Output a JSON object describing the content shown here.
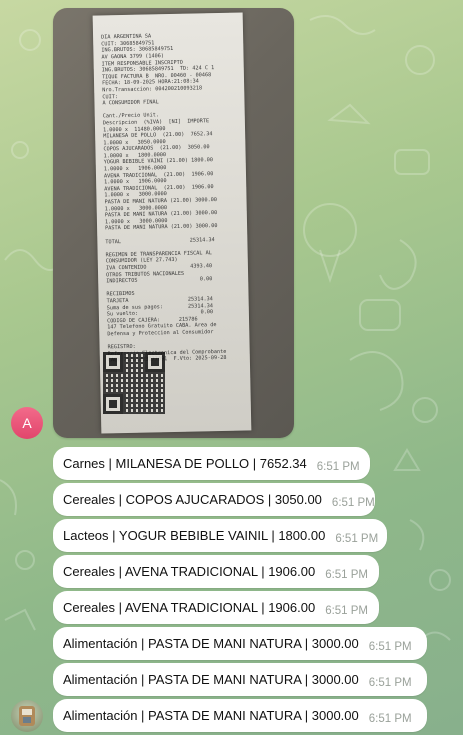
{
  "chat": {
    "sender_avatar_letter": "A",
    "receipt_lines": [
      "DIA ARGENTINA SA",
      "CUIT: 30685849751",
      "ING.BRUTOS: 30685849751",
      "AV GAONA 3799 (1406)",
      "ITEM RESPONSABLE INSCRIPTO",
      "ING.BRUTOS: 30685849751  TD: 424 C 1",
      "TIQUE FACTURA B  NRO. 00460 - 00468",
      "FECHA: 18-09-2025 HORA:21:08:34",
      "Nro.Transaccion: 004200210093218",
      "CUIT:",
      "A CONSUMIDOR FINAL",
      "",
      "Cant./Precio Unit.",
      "Descripcion  (%IVA)  [NI]  IMPORTE",
      "1.0000 x  11480.0000",
      "MILANESA DE POLLO  (21.00)  7652.34",
      "1.0000 x   3050.0000",
      "COPOS AJUCARADOS  (21.00)  3050.00",
      "1.0000 x   1800.0000",
      "YOGUR BEBIBLE VAINI (21.00) 1800.00",
      "1.0000 x   1906.0000",
      "AVENA TRADICIONAL  (21.00)  1906.00",
      "1.0000 x   1906.0000",
      "AVENA TRADICIONAL  (21.00)  1906.00",
      "1.0000 x   3000.0000",
      "PASTA DE MANI NATURA (21.00) 3000.00",
      "1.0000 x   3000.0000",
      "PASTA DE MANI NATURA (21.00) 3000.00",
      "1.0000 x   3000.0000",
      "PASTA DE MANI NATURA (21.00) 3000.00",
      "",
      "TOTAL                      25314.34",
      "",
      "REGIMEN DE TRANSPARENCIA FISCAL AL",
      "CONSUMIDOR (LEY 27.743)",
      "IVA CONTENIDO              4393.40",
      "OTROS TRIBUTOS NACIONALES",
      "INDIRECTOS                    0.00",
      "",
      "RECIBIMOS",
      "TARJETA                   25314.34",
      "Suma de sus pagos:        25314.34",
      "Su vuelto:                    0.00",
      "CODIGO DE CAJERA:      215786",
      "147 Telefono Gratuito CABA. Area de",
      "Defensa y Proteccion al Consumidor",
      "",
      "REGISTRO:",
      "Referencia Electronica del Comprobante",
      "CAE: 75381883177091  F.Vto: 2025-09-28"
    ],
    "messages": [
      {
        "text": "Carnes | MILANESA DE POLLO | 7652.34",
        "time": "6:51 PM"
      },
      {
        "text": "Cereales | COPOS AJUCARADOS | 3050.00",
        "time": "6:51 PM"
      },
      {
        "text": "Lacteos | YOGUR BEBIBLE VAINIL | 1800.00",
        "time": "6:51 PM"
      },
      {
        "text": "Cereales | AVENA TRADICIONAL | 1906.00",
        "time": "6:51 PM"
      },
      {
        "text": "Cereales | AVENA TRADICIONAL | 1906.00",
        "time": "6:51 PM"
      },
      {
        "text": "Alimentación | PASTA DE MANI NATURA | 3000.00",
        "time": "6:51 PM"
      },
      {
        "text": "Alimentación | PASTA DE MANI NATURA | 3000.00",
        "time": "6:51 PM"
      },
      {
        "text": "Alimentación | PASTA DE MANI NATURA | 3000.00",
        "time": "6:51 PM"
      }
    ]
  }
}
